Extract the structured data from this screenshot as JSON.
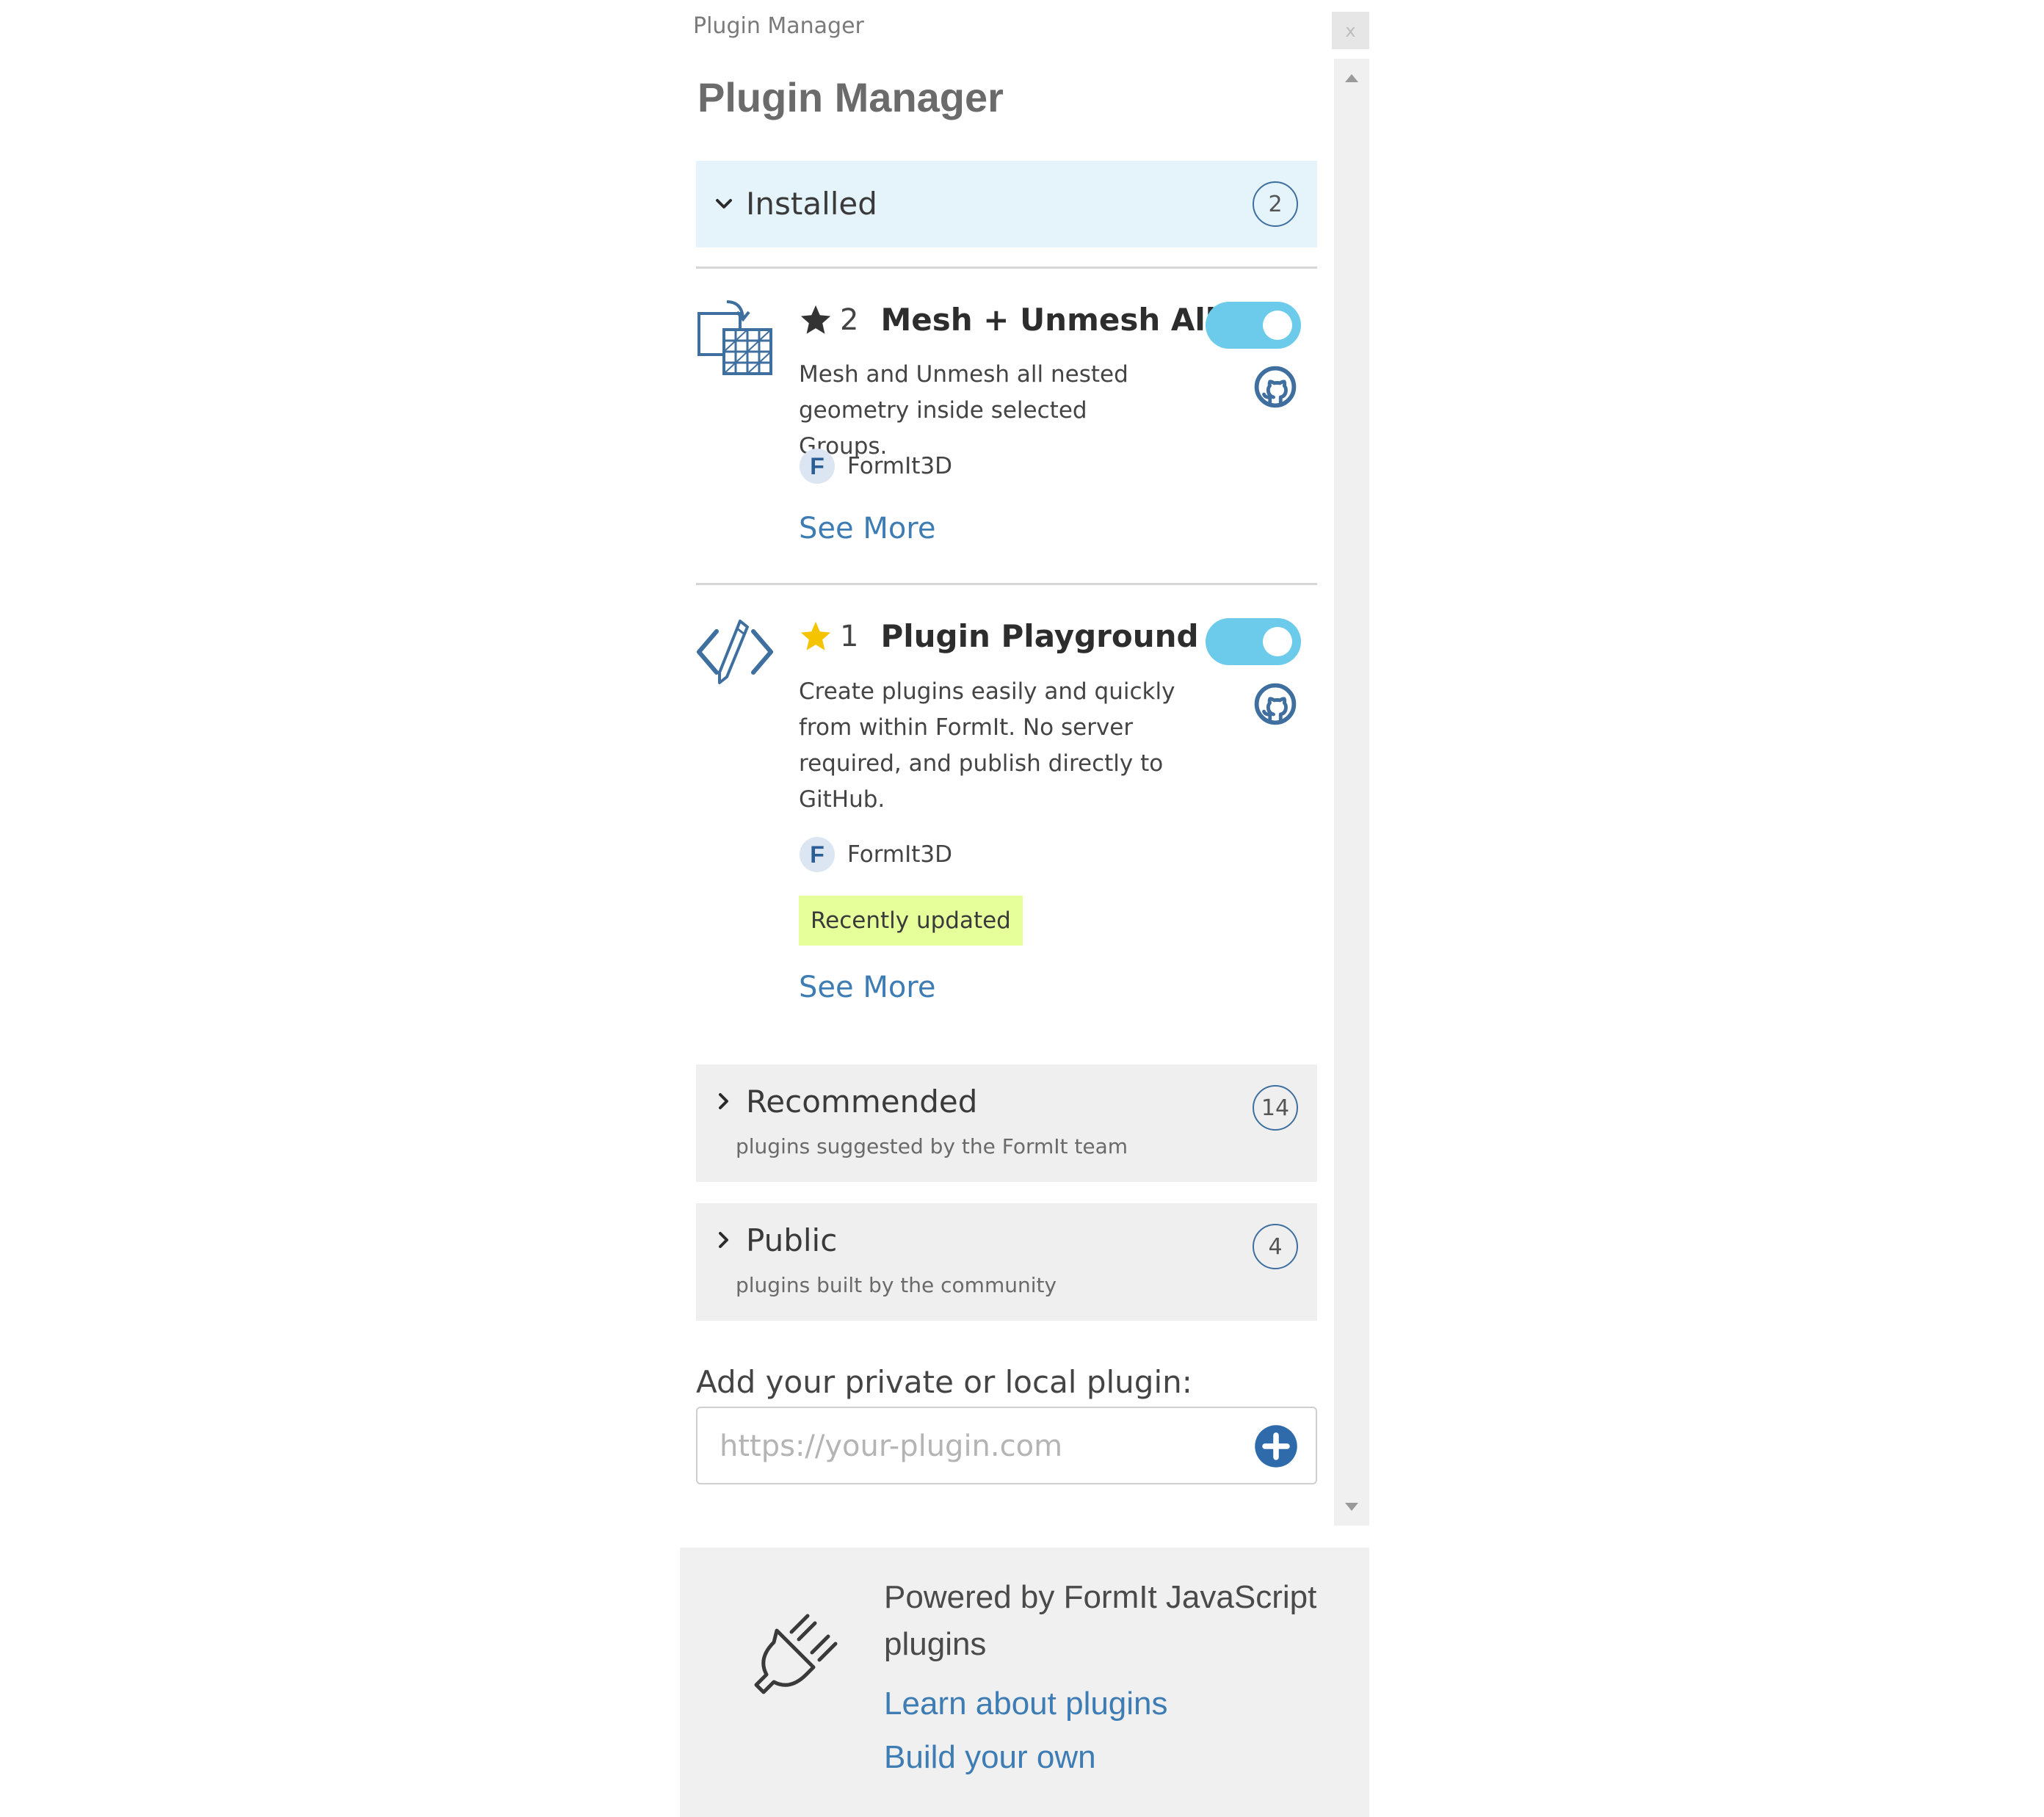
{
  "window": {
    "title": "Plugin Manager",
    "close_label": "x"
  },
  "header": {
    "title": "Plugin Manager"
  },
  "sections": {
    "installed": {
      "label": "Installed",
      "count": "2",
      "expanded": true
    },
    "recommended": {
      "label": "Recommended",
      "subtitle": "plugins suggested by the FormIt team",
      "count": "14",
      "expanded": false
    },
    "public": {
      "label": "Public",
      "subtitle": "plugins built by the community",
      "count": "4",
      "expanded": false
    }
  },
  "plugins": [
    {
      "icon": "mesh-icon",
      "stars": "2",
      "starred": false,
      "name": "Mesh + Unmesh All",
      "description": "Mesh and Unmesh all nested geometry inside selected Groups.",
      "author": "FormIt3D",
      "author_logo_letter": "F",
      "enabled": true,
      "see_more": "See More"
    },
    {
      "icon": "code-edit-icon",
      "stars": "1",
      "starred": true,
      "name": "Plugin Playground",
      "description": "Create plugins easily and quickly from within FormIt. No server required, and publish directly to GitHub.",
      "author": "FormIt3D",
      "author_logo_letter": "F",
      "badge": "Recently updated",
      "enabled": true,
      "see_more": "See More"
    }
  ],
  "add_plugin": {
    "label": "Add your private or local plugin:",
    "placeholder": "https://your-plugin.com",
    "value": ""
  },
  "footer": {
    "text": "Powered by FormIt JavaScript plugins",
    "learn_link": "Learn about plugins",
    "build_link": "Build your own"
  },
  "colors": {
    "accent_link": "#3e7cb4",
    "toggle_on": "#6ccbea",
    "star_gold": "#f5c400",
    "badge_bg": "#e7ff9b",
    "installed_bg": "#e5f4fb"
  }
}
